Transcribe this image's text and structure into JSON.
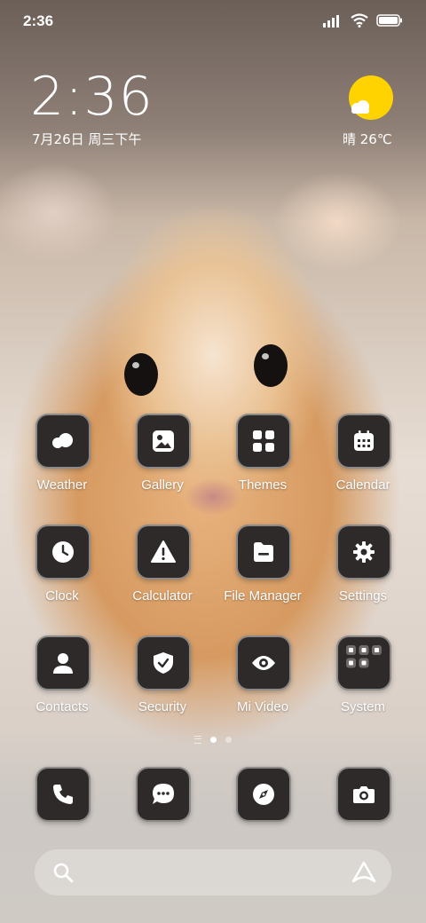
{
  "status_bar": {
    "time": "2:36"
  },
  "lock_widget": {
    "time": "2:36",
    "date": "7月26日 周三下午",
    "weather": "晴 26℃"
  },
  "apps": [
    {
      "name": "weather",
      "label": "Weather",
      "icon": "cloud-icon"
    },
    {
      "name": "gallery",
      "label": "Gallery",
      "icon": "image-icon"
    },
    {
      "name": "themes",
      "label": "Themes",
      "icon": "grid-icon"
    },
    {
      "name": "calendar",
      "label": "Calendar",
      "icon": "calendar-icon"
    },
    {
      "name": "clock",
      "label": "Clock",
      "icon": "clock-icon"
    },
    {
      "name": "calculator",
      "label": "Calculator",
      "icon": "warning-icon"
    },
    {
      "name": "file-manager",
      "label": "File Manager",
      "icon": "folder-icon"
    },
    {
      "name": "settings",
      "label": "Settings",
      "icon": "gear-icon"
    },
    {
      "name": "contacts",
      "label": "Contacts",
      "icon": "person-icon"
    },
    {
      "name": "security",
      "label": "Security",
      "icon": "shield-icon"
    },
    {
      "name": "mi-video",
      "label": "Mi Video",
      "icon": "eye-icon"
    },
    {
      "name": "system",
      "label": "System",
      "icon": "folder-grid-icon"
    }
  ],
  "dock": [
    {
      "name": "phone",
      "icon": "phone-icon"
    },
    {
      "name": "messages",
      "icon": "chat-icon"
    },
    {
      "name": "browser",
      "icon": "compass-icon"
    },
    {
      "name": "camera",
      "icon": "camera-icon"
    }
  ],
  "colors": {
    "tile": "#2d2a29",
    "sun": "#ffd300",
    "text": "#ffffff"
  }
}
